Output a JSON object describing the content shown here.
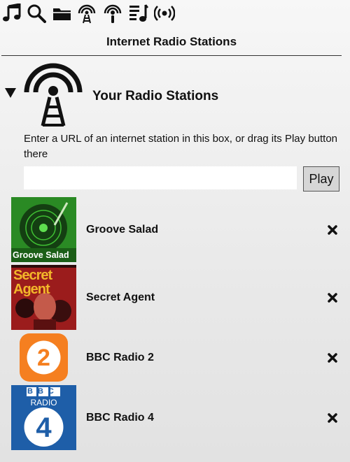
{
  "toolbar": {
    "icons": [
      "music-note-icon",
      "search-icon",
      "folder-icon",
      "radio-tower-icon",
      "podcast-icon",
      "playlist-icon",
      "broadcast-icon"
    ]
  },
  "page": {
    "title": "Internet Radio Stations"
  },
  "section": {
    "title": "Your Radio Stations",
    "expanded": true,
    "hint": "Enter a URL of an internet station in this box, or drag its Play button there",
    "url_value": "",
    "play_label": "Play"
  },
  "stations": [
    {
      "name": "Groove Salad",
      "art_text": "Groove Salad"
    },
    {
      "name": "Secret Agent",
      "art_text": "Secret Agent"
    },
    {
      "name": "BBC Radio 2",
      "art_text": "2"
    },
    {
      "name": "BBC Radio 4",
      "art_text_lines": [
        "BBC",
        "RADIO",
        "4"
      ]
    }
  ],
  "colors": {
    "background": "#ebebeb",
    "groove_green": "#2f9b2a",
    "secret_red": "#9b1c1c",
    "secret_yellow": "#f2b72a",
    "bbc2_orange": "#f57f20",
    "bbc4_blue": "#1e5ea8"
  }
}
